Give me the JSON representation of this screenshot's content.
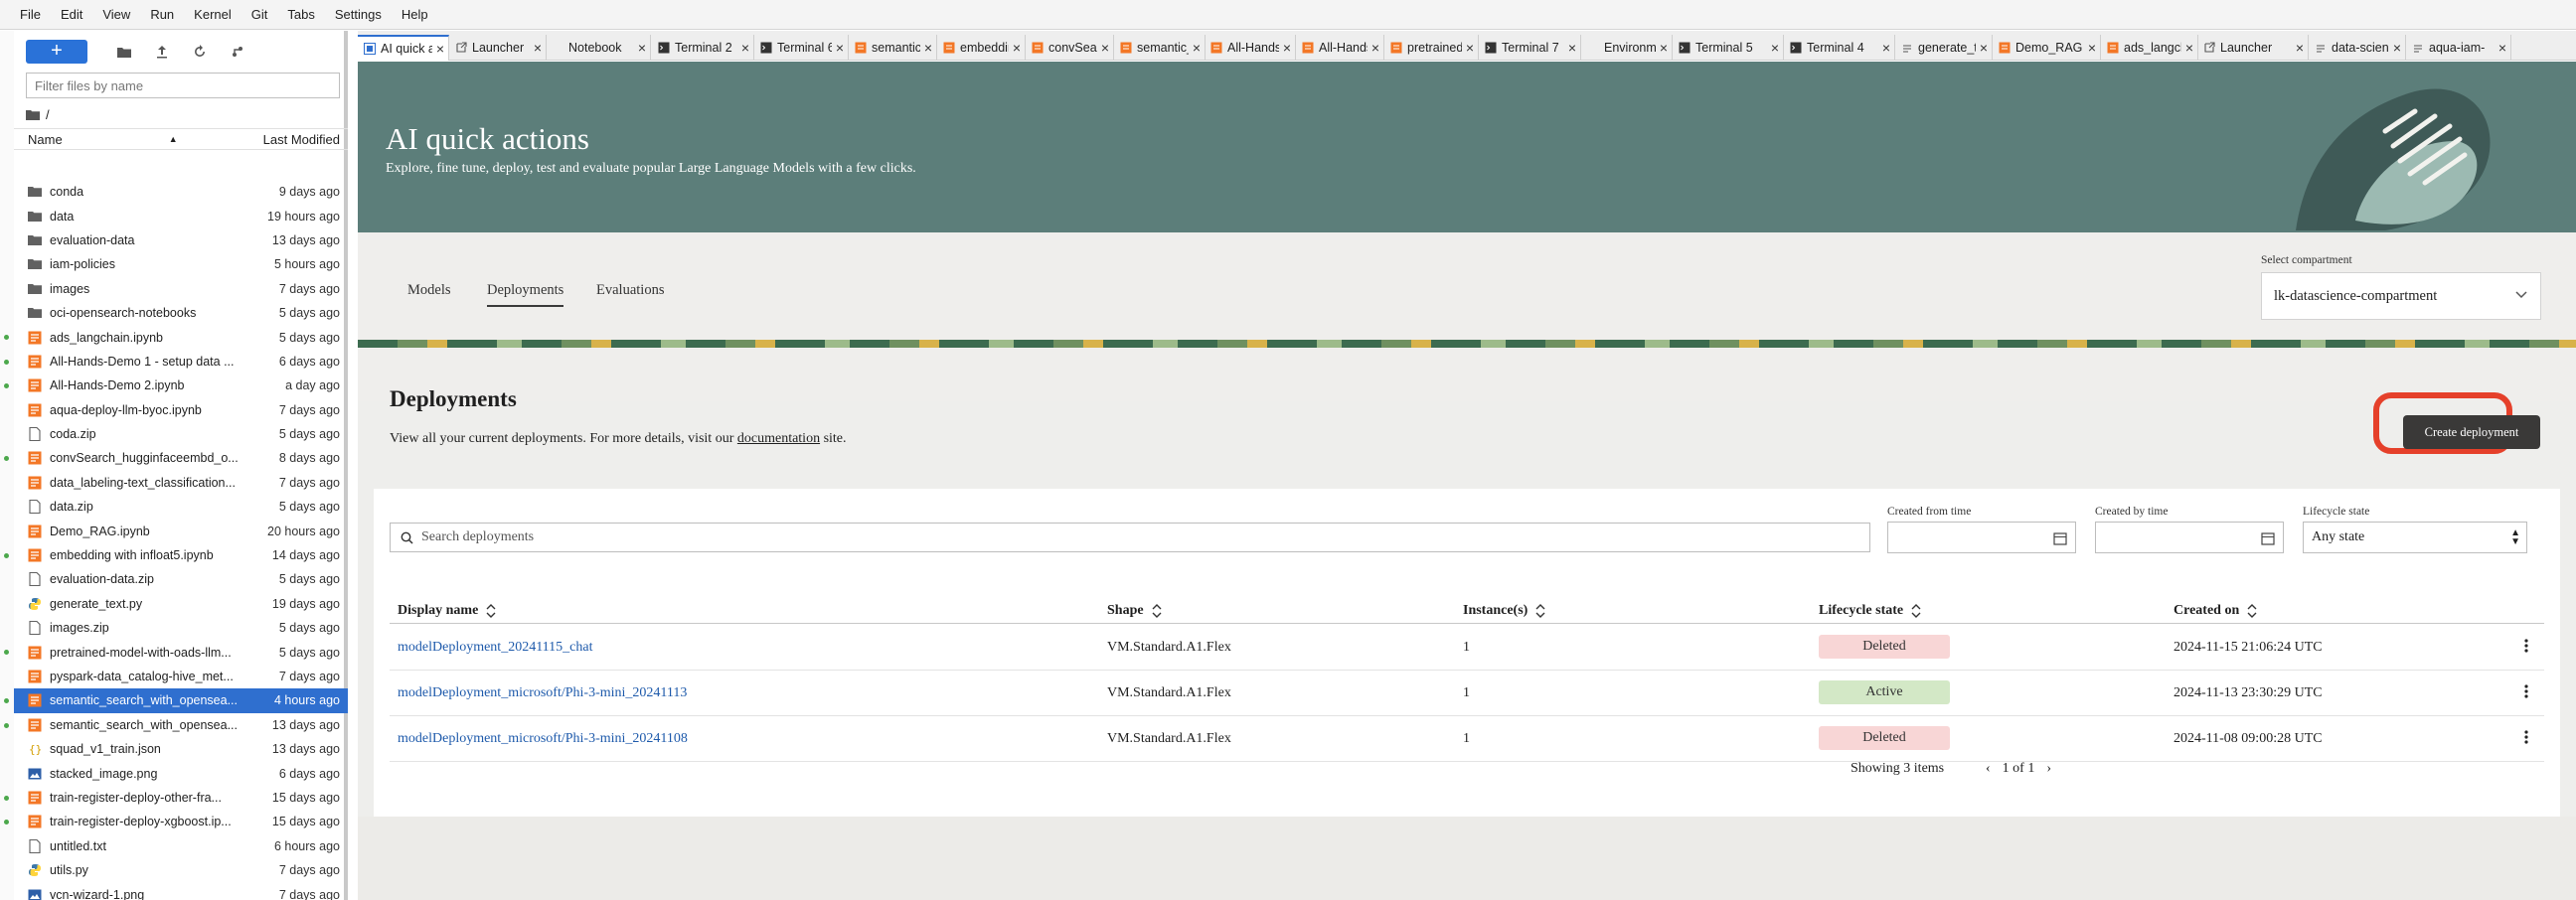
{
  "menu": [
    "File",
    "Edit",
    "View",
    "Run",
    "Kernel",
    "Git",
    "Tabs",
    "Settings",
    "Help"
  ],
  "filebrowser": {
    "new_label": "+",
    "filter_placeholder": "Filter files by name",
    "path": "/",
    "col_name": "Name",
    "col_modified": "Last Modified",
    "files": [
      {
        "name": "conda",
        "modified": "9 days ago",
        "type": "folder",
        "running": false
      },
      {
        "name": "data",
        "modified": "19 hours ago",
        "type": "folder",
        "running": false
      },
      {
        "name": "evaluation-data",
        "modified": "13 days ago",
        "type": "folder",
        "running": false
      },
      {
        "name": "iam-policies",
        "modified": "5 hours ago",
        "type": "folder",
        "running": false
      },
      {
        "name": "images",
        "modified": "7 days ago",
        "type": "folder",
        "running": false
      },
      {
        "name": "oci-opensearch-notebooks",
        "modified": "5 days ago",
        "type": "folder",
        "running": false
      },
      {
        "name": "ads_langchain.ipynb",
        "modified": "5 days ago",
        "type": "notebook",
        "running": true
      },
      {
        "name": "All-Hands-Demo 1 - setup data ...",
        "modified": "6 days ago",
        "type": "notebook",
        "running": true
      },
      {
        "name": "All-Hands-Demo 2.ipynb",
        "modified": "a day ago",
        "type": "notebook",
        "running": true
      },
      {
        "name": "aqua-deploy-llm-byoc.ipynb",
        "modified": "7 days ago",
        "type": "notebook",
        "running": false
      },
      {
        "name": "coda.zip",
        "modified": "5 days ago",
        "type": "file",
        "running": false
      },
      {
        "name": "convSearch_hugginfaceembd_o...",
        "modified": "8 days ago",
        "type": "notebook",
        "running": true
      },
      {
        "name": "data_labeling-text_classification...",
        "modified": "7 days ago",
        "type": "notebook",
        "running": false
      },
      {
        "name": "data.zip",
        "modified": "5 days ago",
        "type": "file",
        "running": false
      },
      {
        "name": "Demo_RAG.ipynb",
        "modified": "20 hours ago",
        "type": "notebook",
        "running": false
      },
      {
        "name": "embedding with infloat5.ipynb",
        "modified": "14 days ago",
        "type": "notebook",
        "running": true
      },
      {
        "name": "evaluation-data.zip",
        "modified": "5 days ago",
        "type": "file",
        "running": false
      },
      {
        "name": "generate_text.py",
        "modified": "19 days ago",
        "type": "python",
        "running": false
      },
      {
        "name": "images.zip",
        "modified": "5 days ago",
        "type": "file",
        "running": false
      },
      {
        "name": "pretrained-model-with-oads-llm...",
        "modified": "5 days ago",
        "type": "notebook",
        "running": true
      },
      {
        "name": "pyspark-data_catalog-hive_met...",
        "modified": "7 days ago",
        "type": "notebook",
        "running": false
      },
      {
        "name": "semantic_search_with_opensea...",
        "modified": "4 hours ago",
        "type": "notebook",
        "running": true,
        "selected": true
      },
      {
        "name": "semantic_search_with_opensea...",
        "modified": "13 days ago",
        "type": "notebook",
        "running": true
      },
      {
        "name": "squad_v1_train.json",
        "modified": "13 days ago",
        "type": "json",
        "running": false
      },
      {
        "name": "stacked_image.png",
        "modified": "6 days ago",
        "type": "image",
        "running": false
      },
      {
        "name": "train-register-deploy-other-fra...",
        "modified": "15 days ago",
        "type": "notebook",
        "running": true
      },
      {
        "name": "train-register-deploy-xgboost.ip...",
        "modified": "15 days ago",
        "type": "notebook",
        "running": true
      },
      {
        "name": "untitled.txt",
        "modified": "6 hours ago",
        "type": "file",
        "running": false
      },
      {
        "name": "utils.py",
        "modified": "7 days ago",
        "type": "python",
        "running": false
      },
      {
        "name": "vcn-wizard-1.png",
        "modified": "7 days ago",
        "type": "image",
        "running": false
      }
    ]
  },
  "tabs": [
    {
      "label": "AI quick ac",
      "icon": "aqua",
      "active": true
    },
    {
      "label": "Launcher",
      "icon": "launcher"
    },
    {
      "label": "Notebook",
      "icon": "none"
    },
    {
      "label": "Terminal 2",
      "icon": "terminal"
    },
    {
      "label": "Terminal 6",
      "icon": "terminal"
    },
    {
      "label": "semantic_",
      "icon": "notebook"
    },
    {
      "label": "embedding",
      "icon": "notebook"
    },
    {
      "label": "convSearc",
      "icon": "notebook"
    },
    {
      "label": "semantic_s",
      "icon": "notebook"
    },
    {
      "label": "All-Hands-",
      "icon": "notebook"
    },
    {
      "label": "All-Hands-",
      "icon": "notebook"
    },
    {
      "label": "pretrained",
      "icon": "notebook"
    },
    {
      "label": "Terminal 7",
      "icon": "terminal"
    },
    {
      "label": "Environme",
      "icon": "none"
    },
    {
      "label": "Terminal 5",
      "icon": "terminal"
    },
    {
      "label": "Terminal 4",
      "icon": "terminal"
    },
    {
      "label": "generate_t",
      "icon": "file"
    },
    {
      "label": "Demo_RAG",
      "icon": "notebook"
    },
    {
      "label": "ads_langcl",
      "icon": "notebook"
    },
    {
      "label": "Launcher",
      "icon": "launcher"
    },
    {
      "label": "data-scien",
      "icon": "file"
    },
    {
      "label": "aqua-iam-",
      "icon": "file"
    }
  ],
  "hero": {
    "title": "AI quick actions",
    "subtitle": "Explore, fine tune, deploy, test and evaluate popular Large Language Models with a few clicks."
  },
  "nav": {
    "tabs": [
      "Models",
      "Deployments",
      "Evaluations"
    ],
    "active": "Deployments",
    "compartment_label": "Select compartment",
    "compartment_value": "lk-datascience-compartment"
  },
  "deployments": {
    "title": "Deployments",
    "desc_prefix": "View all your current deployments. For more details, visit our ",
    "desc_link": "documentation",
    "desc_suffix": " site.",
    "create_label": "Create deployment",
    "search_placeholder": "Search deployments",
    "filters": {
      "from_label": "Created from time",
      "by_label": "Created by time",
      "state_label": "Lifecycle state",
      "state_value": "Any state"
    },
    "columns": [
      "Display name",
      "Shape",
      "Instance(s)",
      "Lifecycle state",
      "Created on"
    ],
    "rows": [
      {
        "name": "modelDeployment_20241115_chat",
        "shape": "VM.Standard.A1.Flex",
        "instances": "1",
        "state": "Deleted",
        "created": "2024-11-15 21:06:24 UTC"
      },
      {
        "name": "modelDeployment_microsoft/Phi-3-mini_20241113",
        "shape": "VM.Standard.A1.Flex",
        "instances": "1",
        "state": "Active",
        "created": "2024-11-13 23:30:29 UTC"
      },
      {
        "name": "modelDeployment_microsoft/Phi-3-mini_20241108",
        "shape": "VM.Standard.A1.Flex",
        "instances": "1",
        "state": "Deleted",
        "created": "2024-11-08 09:00:28 UTC"
      }
    ],
    "showing": "Showing 3 items",
    "page": "1 of 1"
  },
  "colors": {
    "accent": "#2f6fcf",
    "hero": "#5c7e7a",
    "deleted": "#f8d6d6",
    "active": "#d3e8c6",
    "highlight": "#e5402a"
  }
}
